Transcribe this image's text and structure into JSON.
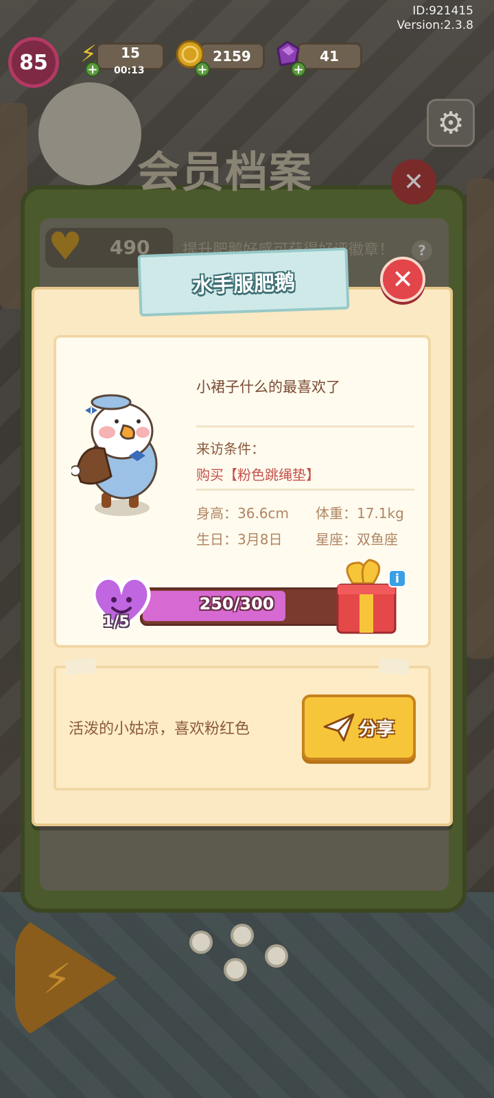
{
  "hud": {
    "user_id": "ID:921415",
    "version": "Version:2.3.8",
    "level": "85",
    "energy": "15",
    "energy_timer": "00:13",
    "coins": "2159",
    "gems": "41",
    "icons": [
      "lightning-icon",
      "coin-icon",
      "gem-icon",
      "gear-icon"
    ]
  },
  "background": {
    "title": "会员档案",
    "favor_value": "490",
    "favor_hint": "提升肥鹅好感可获得好评徽章！"
  },
  "modal": {
    "title": "水手服肥鹅",
    "quote": "小裙子什么的最喜欢了",
    "visit_condition_label": "来访条件：",
    "visit_condition_value": "购买【粉色跳绳垫】",
    "height": "身高：36.6cm",
    "weight": "体重：17.1kg",
    "birthday": "生日：3月8日",
    "zodiac": "星座：双鱼座",
    "progress_text": "250/300",
    "progress_fraction": 0.833,
    "heart_level": "1/5",
    "description": "活泼的小姑凉，喜欢粉红色",
    "share_label": "分享"
  },
  "colors": {
    "modal_bg": "#fbe9c4",
    "ribbon": "#cfe9e9",
    "close": "#e2454a",
    "progress_fill": "#d769d2",
    "share_button": "#f7c53a"
  }
}
